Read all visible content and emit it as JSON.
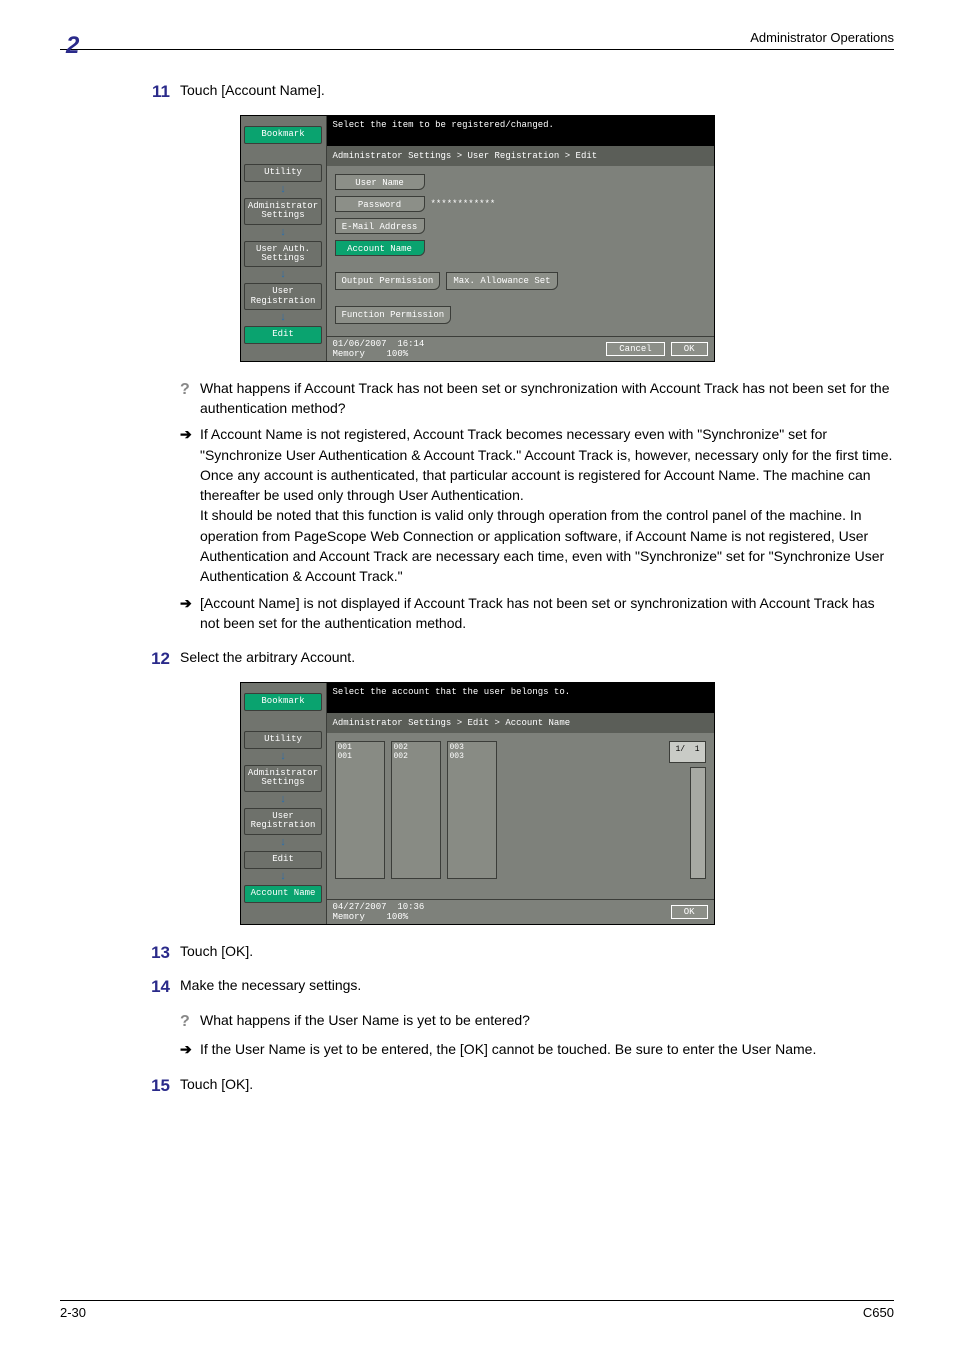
{
  "header": {
    "title": "Administrator Operations",
    "chapter_num": "2"
  },
  "steps": {
    "s11": {
      "num": "11",
      "text": "Touch [Account Name]."
    },
    "s12": {
      "num": "12",
      "text": "Select the arbitrary Account."
    },
    "s13": {
      "num": "13",
      "text": "Touch [OK]."
    },
    "s14": {
      "num": "14",
      "text": "Make the necessary settings."
    },
    "s15": {
      "num": "15",
      "text": "Touch [OK]."
    }
  },
  "notes": {
    "n1q": "What happens if Account Track has not been set or synchronization with Account Track has not been set for the authentication method?",
    "n1a": "If Account Name is not registered, Account Track becomes necessary even with \"Synchronize\" set for \"Synchronize User Authentication & Account Track.\" Account Track is, however, necessary only for the first time. Once any account is authenticated, that particular account is registered for Account Name. The machine can thereafter be used only through User Authentication.\nIt should be noted that this function is valid only through operation from the control panel of the machine. In operation from PageScope Web Connection or application software, if Account Name is not registered, User Authentication and Account Track are necessary each time, even with \"Synchronize\" set for \"Synchronize User Authentication & Account Track.\"",
    "n1b": "[Account Name] is not displayed if Account Track has not been set or synchronization with Account Track has not been set for the authentication method.",
    "n2q": "What happens if the User Name is yet to be entered?",
    "n2a": "If the User Name is yet to be entered, the [OK] cannot be touched. Be sure to enter the User Name."
  },
  "panel1": {
    "header": "Select the item to be registered/changed.",
    "breadcrumb": "Administrator Settings > User Registration > Edit",
    "side": {
      "bookmark": "Bookmark",
      "utility": "Utility",
      "admin": "Administrator Settings",
      "userauth": "User Auth. Settings",
      "userreg": "User Registration",
      "edit": "Edit"
    },
    "fields": {
      "username": "User Name",
      "password": "Password",
      "password_val": "************",
      "email": "E-Mail Address",
      "account": "Account Name",
      "output_perm": "Output Permission",
      "max_allow": "Max. Allowance Set",
      "func_perm": "Function Permission"
    },
    "status": {
      "date": "01/06/2007",
      "time": "16:14",
      "memory": "Memory",
      "mempct": "100%",
      "cancel": "Cancel",
      "ok": "OK"
    }
  },
  "panel2": {
    "header": "Select the account that the user belongs to.",
    "breadcrumb": "Administrator Settings > Edit > Account Name",
    "side": {
      "bookmark": "Bookmark",
      "utility": "Utility",
      "admin": "Administrator Settings",
      "userreg": "User Registration",
      "edit": "Edit",
      "account": "Account Name"
    },
    "accounts": [
      {
        "id": "001",
        "name": "001"
      },
      {
        "id": "002",
        "name": "002"
      },
      {
        "id": "003",
        "name": "003"
      }
    ],
    "page_indicator": "1/  1",
    "status": {
      "date": "04/27/2007",
      "time": "10:36",
      "memory": "Memory",
      "mempct": "100%",
      "ok": "OK"
    }
  },
  "footer": {
    "left": "2-30",
    "right": "C650"
  }
}
